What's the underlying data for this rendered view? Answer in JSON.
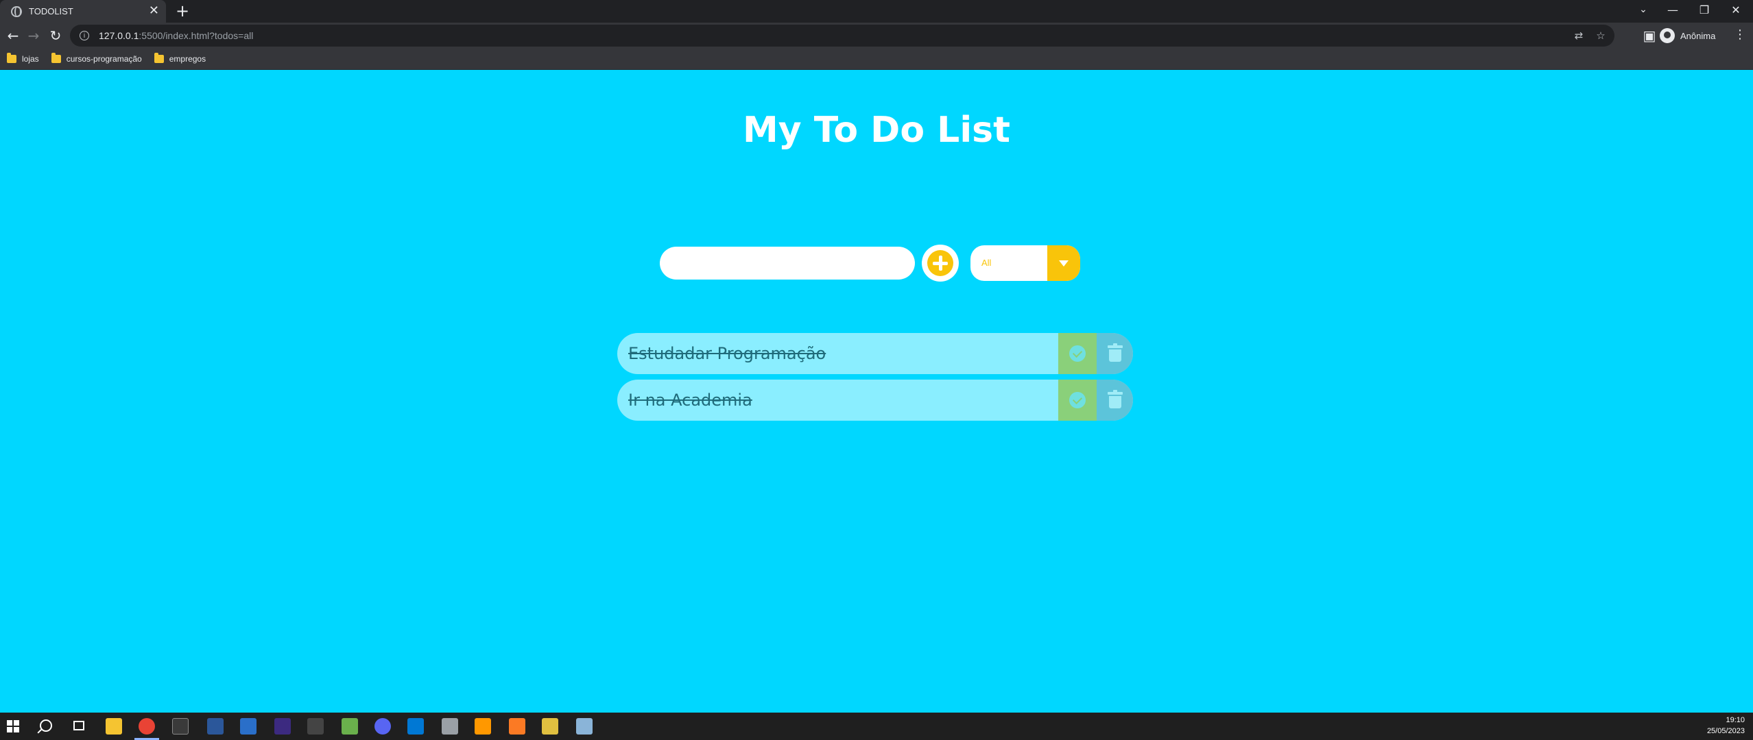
{
  "browser": {
    "tab_title": "TODOLIST",
    "tab_close": "✕",
    "new_tab": "+",
    "url_host": "127.0.0.1",
    "url_rest": ":5500/index.html?todos=all",
    "profile_name": "Anônima",
    "bookmarks": [
      "lojas",
      "cursos-programação",
      "empregos"
    ],
    "window_controls": [
      "⌄",
      "—",
      "❐",
      "✕"
    ]
  },
  "app": {
    "title": "My To Do List",
    "input_value": "",
    "filter_value": "All",
    "todos": [
      {
        "text": "Estudadar Programação",
        "completed": true
      },
      {
        "text": "Ir na Academia",
        "completed": true
      }
    ]
  },
  "taskbar": {
    "time": "19:10",
    "date": "25/05/2023"
  },
  "colors": {
    "background": "#00d7ff",
    "accent": "#f9c40a",
    "todo_bg": "#8aeeff",
    "check_bg": "#8ad07a",
    "trash_bg": "#5cc4da"
  }
}
